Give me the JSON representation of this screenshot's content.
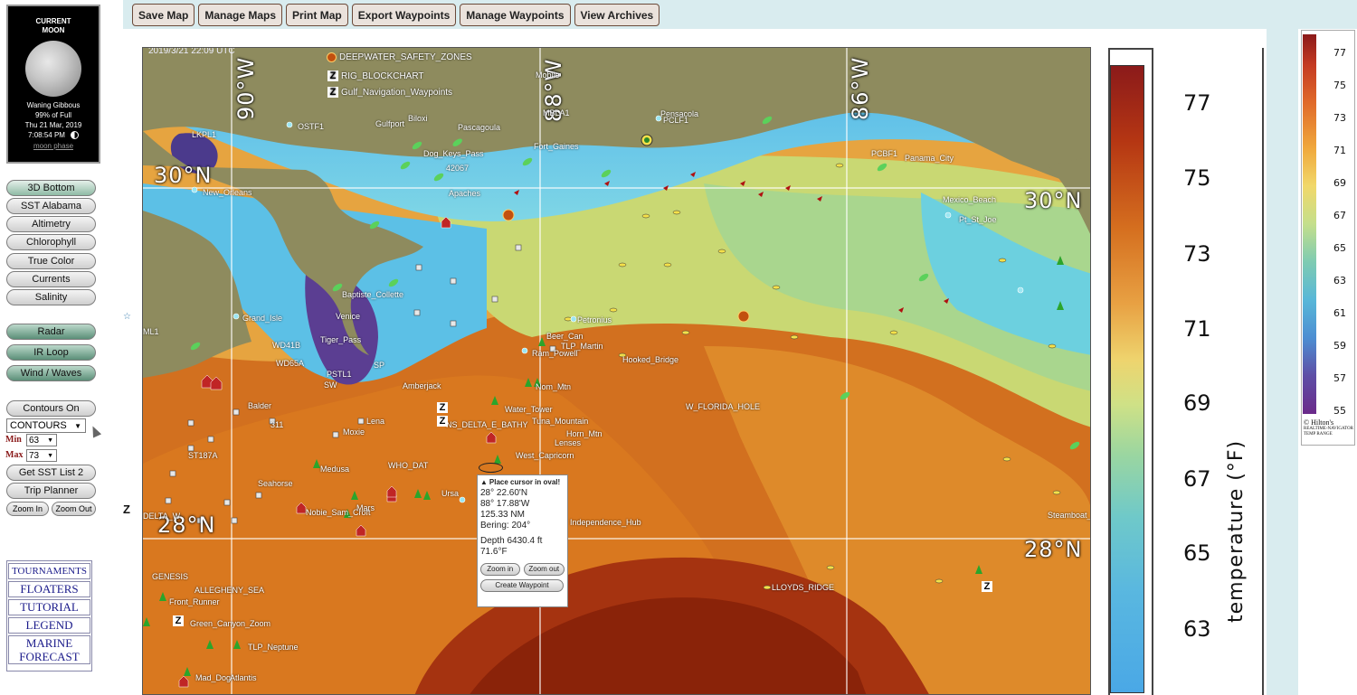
{
  "toolbar": {
    "buttons": [
      "Save Map",
      "Manage Maps",
      "Print Map",
      "Export Waypoints",
      "Manage Waypoints",
      "View Archives"
    ]
  },
  "moon": {
    "title_line1": "CURRENT",
    "title_line2": "MOON",
    "phase": "Waning Gibbous",
    "illumination": "99% of Full",
    "date": "Thu 21 Mar, 2019",
    "time": "7:08:54 PM",
    "link": "moon phase"
  },
  "layers": {
    "bottom": "3D Bottom",
    "sst": "SST Alabama",
    "altimetry": "Altimetry",
    "chlorophyll": "Chlorophyll",
    "true_color": "True Color",
    "currents": "Currents",
    "salinity": "Salinity",
    "radar": "Radar",
    "ir_loop": "IR Loop",
    "wind_waves": "Wind / Waves"
  },
  "contours": {
    "toggle": "Contours On",
    "select_value": "CONTOURS",
    "min_label": "Min",
    "min_value": "63",
    "max_label": "Max",
    "max_value": "73"
  },
  "tools": {
    "sst_list": "Get SST List 2",
    "trip_planner": "Trip Planner",
    "zoom_in": "Zoom In",
    "zoom_out": "Zoom Out"
  },
  "links": [
    "TOURNAMENTS",
    "FLOATERS",
    "TUTORIAL",
    "LEGEND",
    "MARINE FORECAST"
  ],
  "map": {
    "timestamp": "2019/3/21 22:09 UTC",
    "grid": {
      "lon_90": "90°W",
      "lon_88": "88°W",
      "lon_86": "86°W",
      "lat_30_left": "30°N",
      "lat_30_right": "30°N",
      "lat_28_left": "28°N",
      "lat_28_right": "28°N"
    },
    "overlay_layers": [
      "DEEPWATER_SAFETY_ZONES",
      "RIG_BLOCKCHART",
      "Gulf_Navigation_Waypoints"
    ],
    "labels": [
      "LKPL1",
      "OSTF1",
      "Gulfport",
      "Biloxi",
      "Pascagoula",
      "Mobile",
      "MBLA1",
      "Pensacola",
      "PCLF1",
      "Fort_Gaines",
      "Dog_Keys_Pass",
      "New_Orleans",
      "Panama_City",
      "PCBF1",
      "Mexico_Beach",
      "Pt_St_Joe",
      "Baptiste_Collette",
      "Venice",
      "Grand_Isle",
      "Tiger_Pass",
      "PSTL1",
      "WD41B",
      "WD65A",
      "SW",
      "SP",
      "Amberjack",
      "Lena",
      "Moxie",
      "Medusa",
      "WHO_DAT",
      "Seahorse",
      "Balder",
      "311",
      "ST187A",
      "ALLEGHENY_SEA",
      "Front_Runner",
      "Green_Canyon_Zoom",
      "TLP_Neptune",
      "Mad_Dog",
      "Atlantis",
      "Nobie_Sam_Croft",
      "Mars",
      "Ursa",
      "Beer_Can",
      "TLP_Martin",
      "Ram_Powell",
      "Nom_Mtn",
      "Tuna_Mountain",
      "Independence_Hub",
      "LLOYDS_RIDGE",
      "W_FLORIDA_HOLE",
      "Hooked_Bridge",
      "42067",
      "Apaches",
      "Petronius",
      "Horn_Mtn",
      "West_Capricorn",
      "NS_DELTA_E_BATHY",
      "Water_Tower",
      "Lenses",
      "Steamboat_Lumps",
      "ML1",
      "GENESIS",
      "DELTA_W"
    ],
    "popup": {
      "heading": "Place cursor in oval!",
      "lat": "28° 22.60'N",
      "lon": "88° 17.88'W",
      "distance": "125.33 NM",
      "bearing": "Bering: 204°",
      "depth": "Depth 6430.4 ft",
      "temp": "71.6°F",
      "zoom_in": "Zoom in",
      "zoom_out": "Zoom out",
      "create_waypoint": "Create Waypoint"
    }
  },
  "legend_main": {
    "ticks": [
      "77",
      "75",
      "73",
      "71",
      "69",
      "67",
      "65",
      "63"
    ],
    "title": "temperature (°F)"
  },
  "legend_small": {
    "ticks": [
      "77",
      "75",
      "73",
      "71",
      "69",
      "67",
      "65",
      "63",
      "61",
      "59",
      "57",
      "55"
    ],
    "credit": "© Hilton's",
    "sub1": "REALTIME-NAVIGATOR",
    "sub2": "TEMP RANGE"
  },
  "colors": {
    "land": "#8e8b5e",
    "shelf_water": "#63c4e8",
    "warm_water": "#d8782a",
    "hot_water": "#9a2a0e",
    "button_border": "#6b4a3a"
  }
}
